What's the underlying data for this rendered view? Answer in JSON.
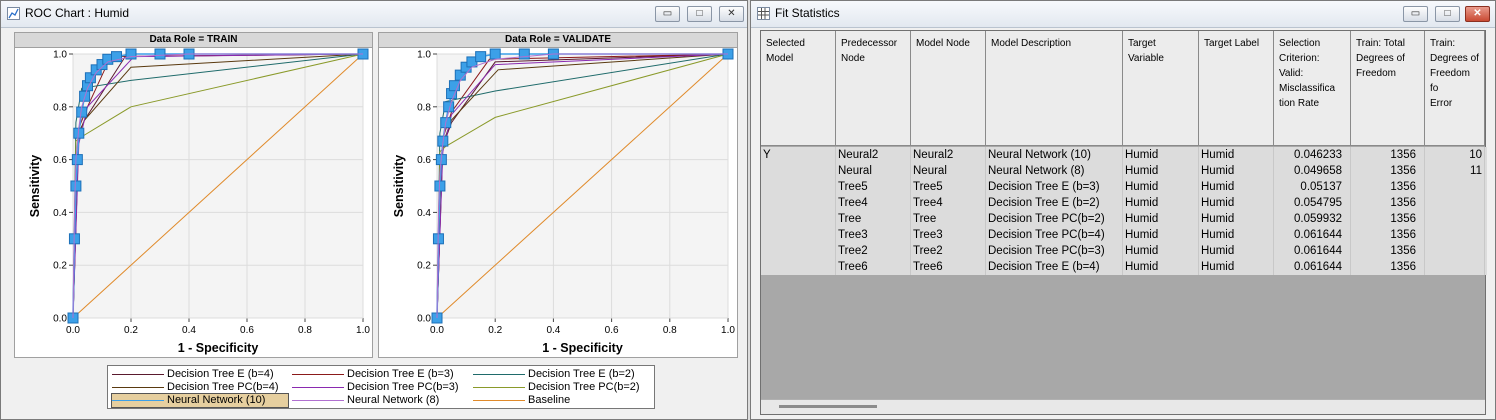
{
  "roc_window": {
    "title": "ROC Chart : Humid",
    "icon": "roc-chart-icon",
    "buttons": {
      "minimize": "▭",
      "maximize": "□",
      "close": "✕"
    }
  },
  "fit_window": {
    "title": "Fit Statistics",
    "icon": "table-icon",
    "buttons": {
      "minimize": "▭",
      "maximize": "□",
      "close": "✕"
    }
  },
  "panels": [
    {
      "header": "Data Role = TRAIN"
    },
    {
      "header": "Data Role = VALIDATE"
    }
  ],
  "axes": {
    "xlabel": "1 - Specificity",
    "ylabel": "Sensitivity",
    "xticks": [
      "0.0",
      "0.2",
      "0.4",
      "0.6",
      "0.8",
      "1.0"
    ],
    "yticks": [
      "0.0",
      "0.2",
      "0.4",
      "0.6",
      "0.8",
      "1.0"
    ]
  },
  "legend": [
    {
      "label": "Decision Tree E (b=4)",
      "color": "#5a1a2e"
    },
    {
      "label": "Decision Tree E (b=3)",
      "color": "#8b1a1a"
    },
    {
      "label": "Decision Tree E (b=2)",
      "color": "#1f6b6b"
    },
    {
      "label": "Decision Tree PC(b=4)",
      "color": "#5a3a10"
    },
    {
      "label": "Decision Tree PC(b=3)",
      "color": "#8a2ab0"
    },
    {
      "label": "Decision Tree PC(b=2)",
      "color": "#8a9a2a"
    },
    {
      "label": "Neural Network (10)",
      "color": "#3ca0e8",
      "selected": true
    },
    {
      "label": "Neural Network (8)",
      "color": "#b070d0"
    },
    {
      "label": "Baseline",
      "color": "#e08a2a"
    }
  ],
  "chart_data": [
    {
      "type": "line",
      "title": "Data Role = TRAIN",
      "xlabel": "1 - Specificity",
      "ylabel": "Sensitivity",
      "xlim": [
        0,
        1
      ],
      "ylim": [
        0,
        1
      ],
      "grid": true,
      "legend_position": "bottom",
      "series": [
        {
          "name": "Decision Tree E (b=4)",
          "x": [
            0,
            0.02,
            0.04,
            0.18,
            1
          ],
          "y": [
            0,
            0.7,
            0.75,
            0.99,
            1
          ]
        },
        {
          "name": "Decision Tree E (b=3)",
          "x": [
            0,
            0.02,
            0.05,
            0.13,
            1
          ],
          "y": [
            0,
            0.72,
            0.8,
            0.99,
            1
          ]
        },
        {
          "name": "Decision Tree E (b=2)",
          "x": [
            0,
            0.01,
            0.03,
            0.2,
            1
          ],
          "y": [
            0,
            0.74,
            0.87,
            0.9,
            1
          ]
        },
        {
          "name": "Decision Tree PC(b=4)",
          "x": [
            0,
            0.02,
            0.04,
            0.2,
            1
          ],
          "y": [
            0,
            0.7,
            0.75,
            0.95,
            1
          ]
        },
        {
          "name": "Decision Tree PC(b=3)",
          "x": [
            0,
            0.02,
            0.05,
            0.21,
            1
          ],
          "y": [
            0,
            0.66,
            0.8,
            0.99,
            1
          ]
        },
        {
          "name": "Decision Tree PC(b=2)",
          "x": [
            0,
            0.01,
            0.02,
            0.2,
            1
          ],
          "y": [
            0,
            0.67,
            0.68,
            0.8,
            1
          ]
        },
        {
          "name": "Neural Network (10)",
          "x": [
            0,
            0.005,
            0.01,
            0.015,
            0.02,
            0.03,
            0.04,
            0.05,
            0.06,
            0.08,
            0.1,
            0.12,
            0.15,
            0.2,
            0.3,
            0.4,
            1
          ],
          "y": [
            0,
            0.3,
            0.5,
            0.6,
            0.7,
            0.78,
            0.84,
            0.88,
            0.91,
            0.94,
            0.96,
            0.98,
            0.99,
            1,
            1,
            1,
            1
          ]
        },
        {
          "name": "Neural Network (8)",
          "x": [
            0,
            0.005,
            0.01,
            0.02,
            0.03,
            0.05,
            0.08,
            0.12,
            0.2,
            0.4,
            1
          ],
          "y": [
            0,
            0.4,
            0.6,
            0.72,
            0.8,
            0.87,
            0.93,
            0.97,
            0.99,
            1,
            1
          ]
        },
        {
          "name": "Baseline",
          "x": [
            0,
            1
          ],
          "y": [
            0,
            1
          ]
        }
      ]
    },
    {
      "type": "line",
      "title": "Data Role = VALIDATE",
      "xlabel": "1 - Specificity",
      "ylabel": "Sensitivity",
      "xlim": [
        0,
        1
      ],
      "ylim": [
        0,
        1
      ],
      "grid": true,
      "legend_position": "bottom",
      "series": [
        {
          "name": "Decision Tree E (b=4)",
          "x": [
            0,
            0.02,
            0.05,
            0.2,
            1
          ],
          "y": [
            0,
            0.65,
            0.74,
            0.97,
            1
          ]
        },
        {
          "name": "Decision Tree E (b=3)",
          "x": [
            0,
            0.02,
            0.05,
            0.18,
            1
          ],
          "y": [
            0,
            0.68,
            0.78,
            0.98,
            1
          ]
        },
        {
          "name": "Decision Tree E (b=2)",
          "x": [
            0,
            0.01,
            0.03,
            0.2,
            1
          ],
          "y": [
            0,
            0.7,
            0.82,
            0.86,
            1
          ]
        },
        {
          "name": "Decision Tree PC(b=4)",
          "x": [
            0,
            0.02,
            0.05,
            0.21,
            1
          ],
          "y": [
            0,
            0.66,
            0.75,
            0.94,
            1
          ]
        },
        {
          "name": "Decision Tree PC(b=3)",
          "x": [
            0,
            0.02,
            0.05,
            0.2,
            1
          ],
          "y": [
            0,
            0.63,
            0.77,
            0.96,
            1
          ]
        },
        {
          "name": "Decision Tree PC(b=2)",
          "x": [
            0,
            0.01,
            0.03,
            0.2,
            1
          ],
          "y": [
            0,
            0.63,
            0.65,
            0.76,
            1
          ]
        },
        {
          "name": "Neural Network (10)",
          "x": [
            0,
            0.005,
            0.01,
            0.015,
            0.02,
            0.03,
            0.04,
            0.05,
            0.06,
            0.08,
            0.1,
            0.12,
            0.15,
            0.2,
            0.3,
            0.4,
            1
          ],
          "y": [
            0,
            0.3,
            0.5,
            0.6,
            0.67,
            0.74,
            0.8,
            0.85,
            0.88,
            0.92,
            0.95,
            0.97,
            0.99,
            1,
            1,
            1,
            1
          ]
        },
        {
          "name": "Neural Network (8)",
          "x": [
            0,
            0.005,
            0.01,
            0.02,
            0.03,
            0.05,
            0.08,
            0.12,
            0.2,
            0.4,
            1
          ],
          "y": [
            0,
            0.4,
            0.55,
            0.66,
            0.74,
            0.82,
            0.9,
            0.95,
            0.98,
            1,
            1
          ]
        },
        {
          "name": "Baseline",
          "x": [
            0,
            1
          ],
          "y": [
            0,
            1
          ]
        }
      ]
    }
  ],
  "fit_stats": {
    "columns": [
      "Selected\nModel",
      "Predecessor\n Node",
      "Model Node",
      "Model Description",
      "Target\nVariable",
      "Target Label",
      "Selection\nCriterion:\nValid:\nMisclassifica\ntion Rate",
      "Train: Total\nDegrees of\nFreedom",
      "Train:\nDegrees of\nFreedom fo\nError"
    ],
    "rows": [
      [
        "Y",
        "Neural2",
        "Neural2",
        "Neural Network (10)",
        "Humid",
        "Humid",
        "0.046233",
        "1356",
        "10"
      ],
      [
        "",
        "Neural",
        "Neural",
        "Neural Network (8)",
        "Humid",
        "Humid",
        "0.049658",
        "1356",
        "11"
      ],
      [
        "",
        "Tree5",
        "Tree5",
        "Decision Tree E (b=3)",
        "Humid",
        "Humid",
        "0.05137",
        "1356",
        ""
      ],
      [
        "",
        "Tree4",
        "Tree4",
        "Decision Tree E (b=2)",
        "Humid",
        "Humid",
        "0.054795",
        "1356",
        ""
      ],
      [
        "",
        "Tree",
        "Tree",
        "Decision Tree PC(b=2)",
        "Humid",
        "Humid",
        "0.059932",
        "1356",
        ""
      ],
      [
        "",
        "Tree3",
        "Tree3",
        "Decision Tree PC(b=4)",
        "Humid",
        "Humid",
        "0.061644",
        "1356",
        ""
      ],
      [
        "",
        "Tree2",
        "Tree2",
        "Decision Tree PC(b=3)",
        "Humid",
        "Humid",
        "0.061644",
        "1356",
        ""
      ],
      [
        "",
        "Tree6",
        "Tree6",
        "Decision Tree E (b=4)",
        "Humid",
        "Humid",
        "0.061644",
        "1356",
        ""
      ]
    ]
  }
}
